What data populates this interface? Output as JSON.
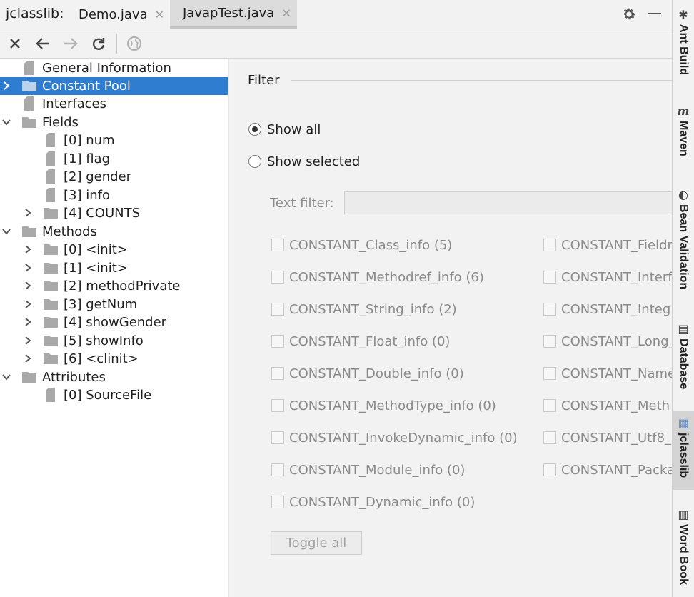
{
  "header": {
    "app_label": "jclasslib:",
    "tabs": [
      {
        "label": "Demo.java",
        "active": false
      },
      {
        "label": "JavapTest.java",
        "active": true
      }
    ]
  },
  "toolbar": {
    "icons": [
      "close-icon",
      "back-icon",
      "forward-icon",
      "refresh-icon",
      "browser-icon"
    ]
  },
  "tree": {
    "general_information": "General Information",
    "constant_pool": "Constant Pool",
    "interfaces": "Interfaces",
    "fields": "Fields",
    "field_items": [
      "[0] num",
      "[1] flag",
      "[2] gender",
      "[3] info",
      "[4] COUNTS"
    ],
    "methods": "Methods",
    "method_items": [
      "[0] <init>",
      "[1] <init>",
      "[2] methodPrivate",
      "[3] getNum",
      "[4] showGender",
      "[5] showInfo",
      "[6] <clinit>"
    ],
    "attributes": "Attributes",
    "attribute_items": [
      "[0] SourceFile"
    ]
  },
  "filter": {
    "title": "Filter",
    "show_all": "Show all",
    "show_selected": "Show selected",
    "text_filter_label": "Text filter:",
    "text_filter_value": "",
    "left_column": [
      "CONSTANT_Class_info (5)",
      "CONSTANT_Methodref_info (6)",
      "CONSTANT_String_info (2)",
      "CONSTANT_Float_info (0)",
      "CONSTANT_Double_info (0)",
      "CONSTANT_MethodType_info (0)",
      "CONSTANT_InvokeDynamic_info (0)",
      "CONSTANT_Module_info (0)",
      "CONSTANT_Dynamic_info (0)"
    ],
    "right_column": [
      "CONSTANT_Fieldr",
      "CONSTANT_Interf",
      "CONSTANT_Integ",
      "CONSTANT_Long_",
      "CONSTANT_Name",
      "CONSTANT_Meth",
      "CONSTANT_Utf8_",
      "CONSTANT_Packa"
    ],
    "toggle_all": "Toggle all"
  },
  "sidebar": {
    "ant_build": "Ant Build",
    "maven": "Maven",
    "bean_validation": "Bean Validation",
    "database": "Database",
    "jclasslib": "jclasslib",
    "word_book": "Word Book"
  },
  "colors": {
    "selection": "#2e7dd1",
    "panel_bg": "#f2f2f2",
    "tree_bg": "#ffffff"
  }
}
